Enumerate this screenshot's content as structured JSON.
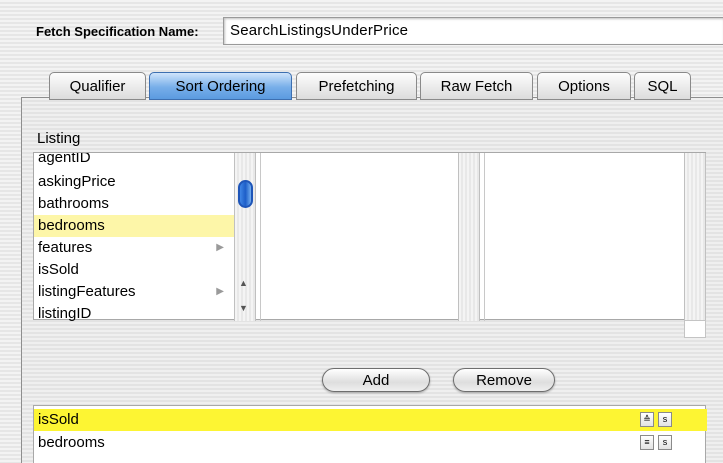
{
  "fetch_spec": {
    "label": "Fetch Specification Name:",
    "value": "SearchListingsUnderPrice"
  },
  "tabs": [
    {
      "label": "Qualifier",
      "active": false
    },
    {
      "label": "Sort Ordering",
      "active": true
    },
    {
      "label": "Prefetching",
      "active": false
    },
    {
      "label": "Raw Fetch",
      "active": false
    },
    {
      "label": "Options",
      "active": false
    },
    {
      "label": "SQL",
      "active": false
    }
  ],
  "browser": {
    "entity_label": "Listing",
    "attributes": [
      {
        "label": "agentID",
        "has_children": false
      },
      {
        "label": "askingPrice",
        "has_children": false
      },
      {
        "label": "bathrooms",
        "has_children": false
      },
      {
        "label": "bedrooms",
        "has_children": false,
        "selected": true
      },
      {
        "label": "features",
        "has_children": true
      },
      {
        "label": "isSold",
        "has_children": false
      },
      {
        "label": "listingFeatures",
        "has_children": true
      },
      {
        "label": "listingID",
        "has_children": false
      }
    ]
  },
  "buttons": {
    "add": "Add",
    "remove": "Remove"
  },
  "sort_orderings": [
    {
      "key": "isSold",
      "direction": "ascending",
      "selected": true,
      "case_icon": "s"
    },
    {
      "key": "bedrooms",
      "direction": "descending",
      "selected": false,
      "case_icon": "s"
    }
  ],
  "icons": {
    "asc": "≙",
    "desc": "≡"
  },
  "colors": {
    "active_tab": "#5b9be0",
    "list_selection": "#fdf6a8",
    "sort_selection": "#fdf533"
  }
}
